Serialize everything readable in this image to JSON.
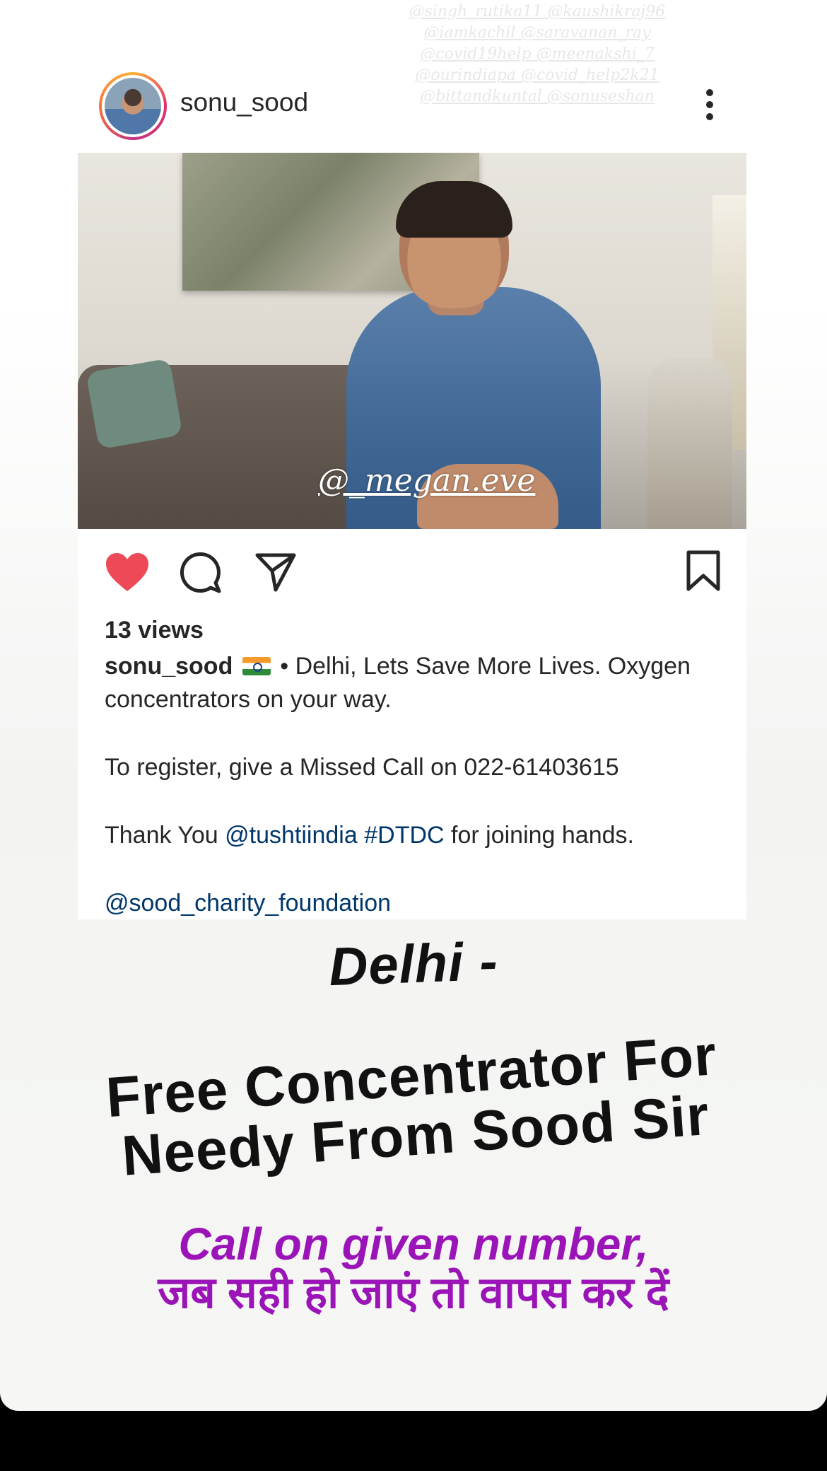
{
  "story": {
    "tagged_users": "@singh_rutika11 @kaushikraj96 @iamkachil @saravanan_ray @covid19help @meenakshi_7 @ourindiapa @covid_help2k21 @bittandkuntal @sonuseshan"
  },
  "post": {
    "username": "sonu_sood",
    "views": "13 views",
    "watermark": "@_megan.eve",
    "caption": {
      "user": "sonu_sood",
      "line1": " • Delhi, Lets Save More Lives. Oxygen concentrators on your way.",
      "line2": "To register, give a Missed Call on 022-61403615",
      "line3_before": "Thank You ",
      "mention": "@tushtiindia",
      "hashtag": "#DTDC",
      "line3_after": " for joining hands.",
      "line4": "@sood_charity_foundation"
    },
    "icons": {
      "avatar": "profile-avatar",
      "more": "more-options-icon",
      "like": "heart-icon",
      "comment": "comment-icon",
      "share": "share-icon",
      "save": "bookmark-icon"
    },
    "colors": {
      "like": "#ed4956",
      "link": "#00376b",
      "overlay_purple": "#9a14b7"
    }
  },
  "overlay": {
    "title": "Delhi -",
    "subtitle_line1": "Free Concentrator For",
    "subtitle_line2": "Needy From Sood Sir",
    "call_line": "Call on given number,",
    "hindi_line": "जब सही हो जाएं तो वापस कर दें"
  }
}
